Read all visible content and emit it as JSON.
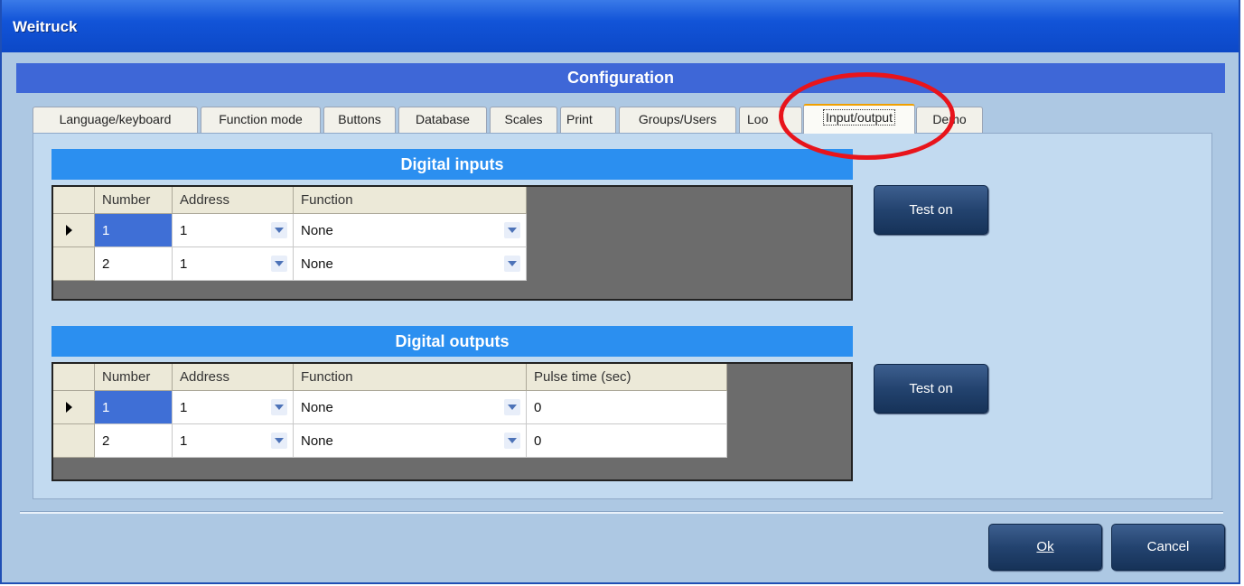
{
  "window": {
    "title": "Weitruck"
  },
  "header": {
    "title": "Configuration"
  },
  "tabs": [
    {
      "label": "Language/keyboard",
      "active": false
    },
    {
      "label": "Function mode",
      "active": false
    },
    {
      "label": "Buttons",
      "active": false
    },
    {
      "label": "Database",
      "active": false
    },
    {
      "label": "Scales",
      "active": false
    },
    {
      "label": "Print",
      "active": false
    },
    {
      "label": "Groups/Users",
      "active": false
    },
    {
      "label": "Loo",
      "active": false
    },
    {
      "label": "Input/output",
      "active": true
    },
    {
      "label": "Demo",
      "active": false
    }
  ],
  "digital_inputs": {
    "title": "Digital inputs",
    "columns": [
      "Number",
      "Address",
      "Function"
    ],
    "rows": [
      {
        "number": "1",
        "address": "1",
        "function": "None"
      },
      {
        "number": "2",
        "address": "1",
        "function": "None"
      }
    ],
    "test_button": "Test on"
  },
  "digital_outputs": {
    "title": "Digital outputs",
    "columns": [
      "Number",
      "Address",
      "Function",
      "Pulse time (sec)"
    ],
    "rows": [
      {
        "number": "1",
        "address": "1",
        "function": "None",
        "pulse": "0"
      },
      {
        "number": "2",
        "address": "1",
        "function": "None",
        "pulse": "0"
      }
    ],
    "test_button": "Test on"
  },
  "footer": {
    "ok_label": "Ok",
    "cancel_label": "Cancel"
  },
  "colors": {
    "title_bar": "#1254d8",
    "header_band": "#3e67d7",
    "group_title": "#2b8ff0",
    "selection": "#3f6fd6",
    "annotation": "#e8141b"
  }
}
